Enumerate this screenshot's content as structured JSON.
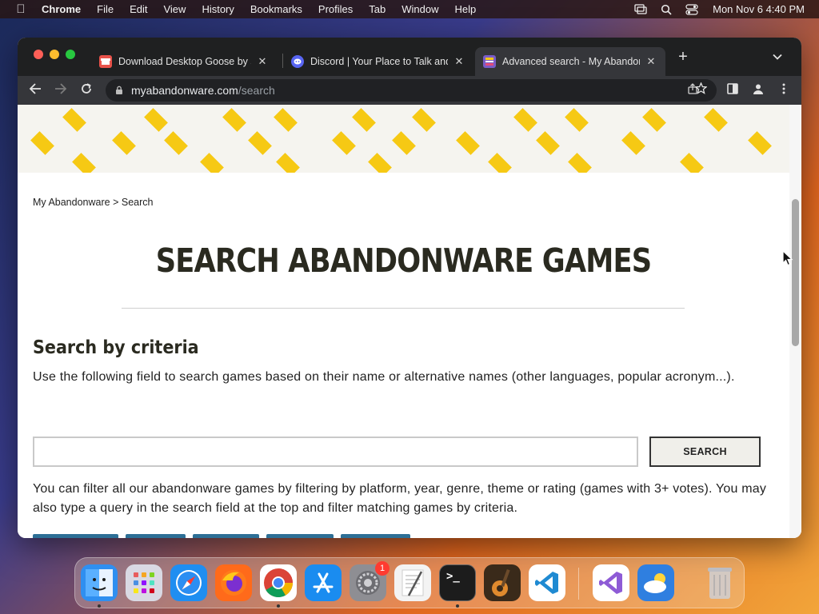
{
  "menubar": {
    "app_name": "Chrome",
    "items": [
      "File",
      "Edit",
      "View",
      "History",
      "Bookmarks",
      "Profiles",
      "Tab",
      "Window",
      "Help"
    ],
    "clock": "Mon Nov 6  4:40 PM"
  },
  "tabs": [
    {
      "title": "Download Desktop Goose by samperson",
      "favicon": "itch-io-icon",
      "favicon_color": "#e8524a",
      "active": false
    },
    {
      "title": "Discord | Your Place to Talk and Hang Out",
      "favicon": "discord-icon",
      "favicon_color": "#5865f2",
      "active": false
    },
    {
      "title": "Advanced search - My Abandonware",
      "favicon": "myabandonware-icon",
      "favicon_color": "#7a5cc7",
      "active": true
    }
  ],
  "address_bar": {
    "host": "myabandonware.com",
    "path": "/search"
  },
  "page": {
    "breadcrumb": {
      "home": "My Abandonware",
      "separator": ">",
      "current": "Search"
    },
    "title": "SEARCH ABANDONWARE GAMES",
    "section_title": "Search by criteria",
    "description": "Use the following field to search games based on their name or alternative names (other languages, popular acronym...).",
    "search_input": {
      "value": "",
      "placeholder": ""
    },
    "search_button": "SEARCH",
    "filter_text": "You can filter all our abandonware games by filtering by platform, year, genre, theme or rating (games with 3+ votes). You may also type a query in the search field at the top and filter matching games by criteria."
  },
  "dock": {
    "apps": [
      {
        "name": "finder-icon",
        "label": "",
        "color": "#2f8ff0",
        "running": true,
        "badge": null
      },
      {
        "name": "launchpad-icon",
        "label": "",
        "color": "#d9d9e3",
        "running": false,
        "badge": null
      },
      {
        "name": "safari-icon",
        "label": "",
        "color": "#1f8ef1",
        "running": false,
        "badge": null
      },
      {
        "name": "firefox-icon",
        "label": "",
        "color": "#ff6a1a",
        "running": false,
        "badge": null
      },
      {
        "name": "chrome-icon",
        "label": "",
        "color": "#ffffff",
        "running": true,
        "badge": null
      },
      {
        "name": "app-store-icon",
        "label": "",
        "color": "#1a8cf0",
        "running": false,
        "badge": null
      },
      {
        "name": "system-settings-icon",
        "label": "",
        "color": "#8e8e93",
        "running": false,
        "badge": "1"
      },
      {
        "name": "textedit-icon",
        "label": "",
        "color": "#f3f3f3",
        "running": false,
        "badge": null
      },
      {
        "name": "terminal-icon",
        "label": ">_",
        "color": "#1c1c1c",
        "running": true,
        "badge": null
      },
      {
        "name": "garageband-icon",
        "label": "",
        "color": "#3a2a1a",
        "running": false,
        "badge": null
      },
      {
        "name": "vscode-icon",
        "label": "",
        "color": "#ffffff",
        "running": false,
        "badge": null
      },
      {
        "name": "visual-studio-icon",
        "label": "",
        "color": "#ffffff",
        "running": false,
        "badge": null
      },
      {
        "name": "weather-icon",
        "label": "",
        "color": "#2f7fe0",
        "running": false,
        "badge": null
      },
      {
        "name": "trash-icon",
        "label": "",
        "color": "transparent",
        "running": false,
        "badge": null
      }
    ]
  },
  "colors": {
    "banner_diamond": "#f6c914",
    "banner_bg": "#f5f4ef",
    "filter_button": "#2d6f96",
    "title_text": "#2a2a20"
  }
}
